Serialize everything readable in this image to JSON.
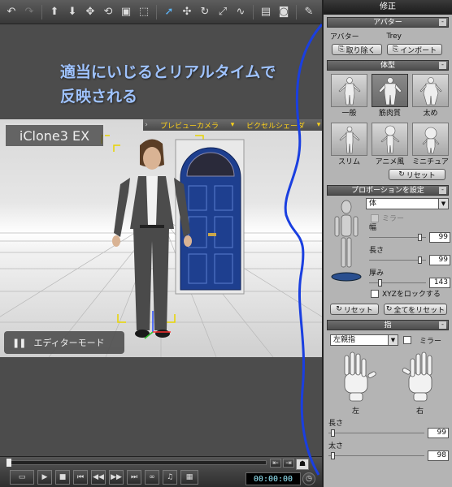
{
  "toolbar": {
    "icons": [
      "undo-icon",
      "redo-icon",
      "move-up-icon",
      "move-down-icon",
      "move-icon",
      "rotate-icon",
      "camera-icon",
      "frame-icon",
      "select-icon",
      "transform-icon",
      "rotate-tool-icon",
      "scale-icon",
      "curve-icon",
      "screen-icon",
      "snapshot-icon",
      "edit-icon"
    ]
  },
  "viewport": {
    "overlay_line1": "適当にいじるとリアルタイムで",
    "overlay_line2": "反映される",
    "brand": "iClone3 EX",
    "camera_label": "プレビューカメラ",
    "shader_label": "ピクセルシェーダ",
    "editor_mode": "エディターモード",
    "timecode": "00:00:00"
  },
  "panel": {
    "title": "修正",
    "avatar": {
      "header": "アバター",
      "label": "アバター",
      "name": "Trey",
      "remove_btn": "取り除く",
      "import_btn": "インポート"
    },
    "body_type": {
      "header": "体型",
      "presets": [
        "一般",
        "筋肉質",
        "太め",
        "スリム",
        "アニメ風",
        "ミニチュア"
      ],
      "selected": "筋肉質",
      "reset_btn": "リセット"
    },
    "proportion": {
      "header": "プロポーションを設定",
      "part": "体",
      "mirror": "ミラー",
      "width_label": "幅",
      "width_value": "99",
      "width_fraction": 0.9,
      "length_label": "長さ",
      "length_value": "99",
      "length_fraction": 0.9,
      "thickness_label": "厚み",
      "thickness_value": "143",
      "thickness_fraction": 0.2,
      "lock_xyz": "XYZをロックする",
      "reset_btn": "リセット",
      "reset_all_btn": "全てをリセット"
    },
    "finger": {
      "header": "指",
      "selected": "左親指",
      "mirror": "ミラー",
      "left_label": "左",
      "right_label": "右",
      "length_label": "長さ",
      "length_value": "99",
      "length_fraction": 0.05,
      "thickness_label": "太さ",
      "thickness_value": "98",
      "thickness_fraction": 0.05
    }
  },
  "colors": {
    "overlay_text": "#9fc3ff",
    "annotation_stroke": "#1a3fe0",
    "accent_yellow": "#ffd21a"
  }
}
